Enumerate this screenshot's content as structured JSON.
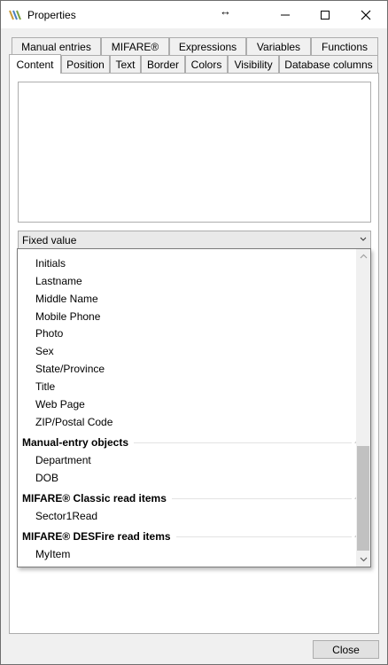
{
  "window": {
    "title": "Properties",
    "resize_glyph": "↔"
  },
  "tabs_row1": [
    "Manual entries",
    "MIFARE®",
    "Expressions",
    "Variables",
    "Functions"
  ],
  "tabs_row2": [
    "Content",
    "Position",
    "Text",
    "Border",
    "Colors",
    "Visibility",
    "Database columns"
  ],
  "active_tab": "Content",
  "content": {
    "textarea_value": "",
    "source_select": "Fixed value"
  },
  "dropdown": {
    "items_top": [
      "Initials",
      "Lastname",
      "Middle Name",
      "Mobile Phone",
      "Photo",
      "Sex",
      "State/Province",
      "Title",
      "Web Page",
      "ZIP/Postal Code"
    ],
    "groups": [
      {
        "title": "Manual-entry objects",
        "items": [
          "Department",
          "DOB"
        ]
      },
      {
        "title": "MIFARE® Classic read items",
        "items": [
          "Sector1Read"
        ]
      },
      {
        "title": "MIFARE® DESFire read items",
        "items": [
          "MyItem"
        ]
      }
    ]
  },
  "buttons": {
    "close": "Close"
  },
  "icons": {
    "app": "properties-app-icon",
    "chevron": "chevron-down-icon",
    "caret": "caret-up-icon"
  }
}
